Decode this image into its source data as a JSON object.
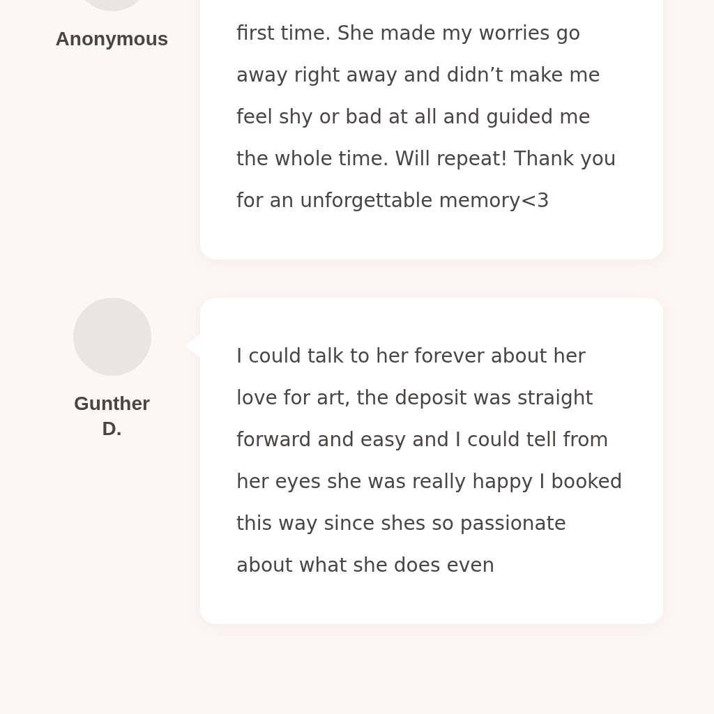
{
  "reviews": [
    {
      "name": "Anonymous",
      "text": "first time. She made my worries go away right away and didn’t make me feel shy or bad at all and guided me the whole time. Will repeat! Thank you for an unforgettable memory<3"
    },
    {
      "name": "Gunther D.",
      "text": "I could talk to her forever about her love for art, the deposit was straight forward and easy and I could tell from her eyes she was really happy I booked this way since shes so passionate about what she does even"
    }
  ]
}
